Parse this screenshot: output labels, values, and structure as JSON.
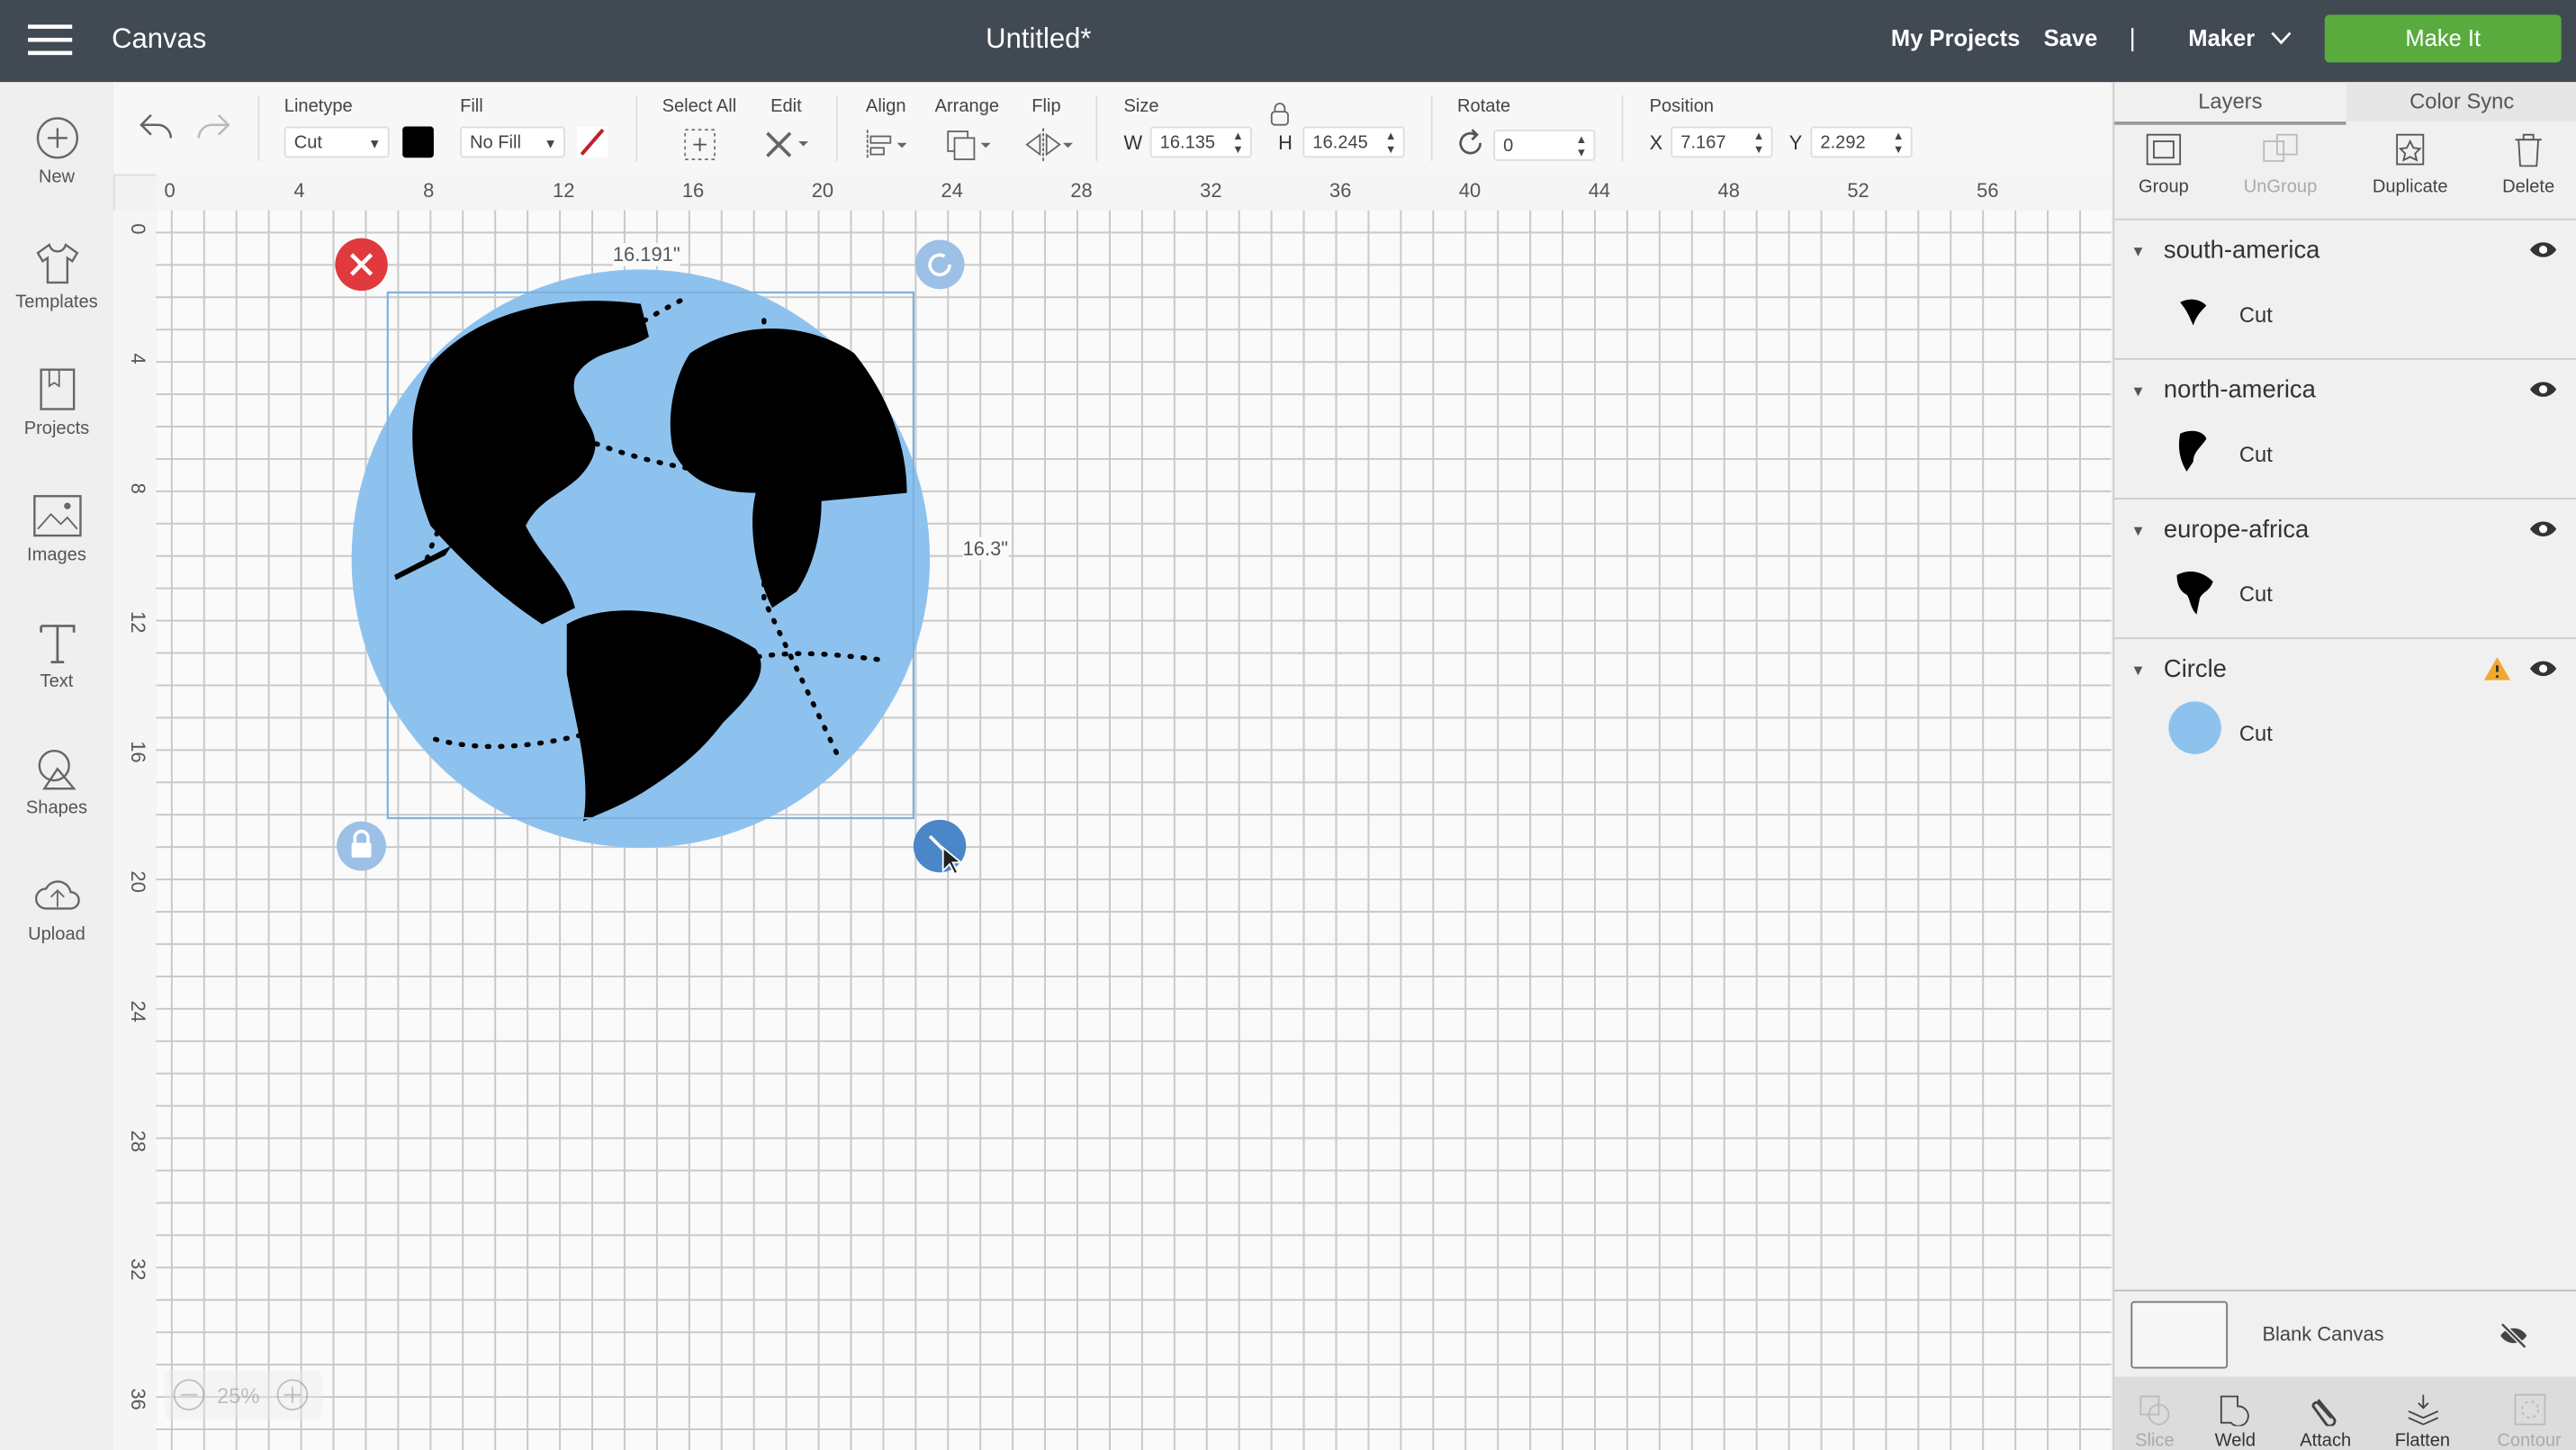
{
  "topbar": {
    "brand": "Canvas",
    "title": "Untitled*",
    "my_projects": "My Projects",
    "save": "Save",
    "divider": "|",
    "machine": "Maker",
    "make_it": "Make It"
  },
  "leftnav": [
    {
      "label": "New",
      "icon": "plus-circle-icon"
    },
    {
      "label": "Templates",
      "icon": "tshirt-icon"
    },
    {
      "label": "Projects",
      "icon": "projects-icon"
    },
    {
      "label": "Images",
      "icon": "image-icon"
    },
    {
      "label": "Text",
      "icon": "text-icon"
    },
    {
      "label": "Shapes",
      "icon": "shapes-icon"
    },
    {
      "label": "Upload",
      "icon": "cloud-upload-icon"
    }
  ],
  "toolbar": {
    "linetype_label": "Linetype",
    "linetype_value": "Cut",
    "linetype_color": "#000000",
    "fill_label": "Fill",
    "fill_value": "No Fill",
    "select_all": "Select All",
    "edit": "Edit",
    "align": "Align",
    "arrange": "Arrange",
    "flip": "Flip",
    "size": "Size",
    "w_label": "W",
    "w_value": "16.135",
    "h_label": "H",
    "h_value": "16.245",
    "rotate": "Rotate",
    "rotate_value": "0",
    "position": "Position",
    "x_label": "X",
    "x_value": "7.167",
    "y_label": "Y",
    "y_value": "2.292"
  },
  "ruler": {
    "h": [
      "0",
      "4",
      "8",
      "12",
      "16",
      "20",
      "24",
      "28",
      "32",
      "36",
      "40",
      "44",
      "48",
      "52",
      "56"
    ],
    "v": [
      "0",
      "4",
      "8",
      "12",
      "16",
      "20",
      "24",
      "28",
      "32",
      "36"
    ]
  },
  "canvas": {
    "width_dim": "16.191\"",
    "height_dim": "16.3\"",
    "zoom": "25%",
    "globe_color": "#8ec2ee"
  },
  "panel": {
    "tabs": [
      "Layers",
      "Color Sync"
    ],
    "buttons": [
      "Group",
      "UnGroup",
      "Duplicate",
      "Delete"
    ],
    "layers": [
      {
        "name": "south-america",
        "op": "Cut"
      },
      {
        "name": "north-america",
        "op": "Cut"
      },
      {
        "name": "europe-africa",
        "op": "Cut"
      },
      {
        "name": "Circle",
        "op": "Cut",
        "warning": true
      }
    ],
    "blank_canvas": "Blank Canvas",
    "bottom": [
      "Slice",
      "Weld",
      "Attach",
      "Flatten",
      "Contour"
    ]
  }
}
